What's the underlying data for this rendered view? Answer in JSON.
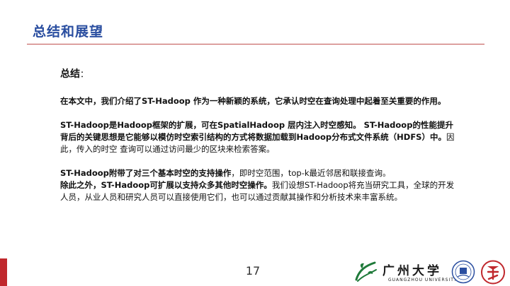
{
  "slide": {
    "title": "总结和展望",
    "heading": "总结",
    "heading_colon": "：",
    "p1": "在本文中，我们介绍了ST-Hadoop 作为一种新颖的系统，它承认时空在查询处理中起着至关重要的作用。",
    "p2_bold": "ST-Hadoop是Hadoop框架的扩展，可在SpatialHadoop 层内注入时空感知。 ST-Hadoop的性能提升背后的关键思想是它能够以模仿时空索引结构的方式将数据加载到Hadoop分布式文件系统（HDFS）中。",
    "p2_normal": "因此，传入的时空 查询可以通过访问最少的区块来检索答案。",
    "p3_bold_1": " ST-Hadoop附带了对三个基本时空的支持操作",
    "p3_normal_1": "，即时空范围，top-k最近邻居和联接查询。",
    "p3_bold_2": "除此之外，ST-Hadoop可扩展以支持众多其他时空操作。",
    "p3_normal_2": "我们设想ST-Hadoop将充当研究工具，全球的开发人员，从业人员和研究人员可以直接使用它们，也可以通过贡献其操作和分析技术来丰富系统。"
  },
  "footer": {
    "page_number": "17",
    "university_name": "广州大学",
    "university_name_en": "GUANGZHOU UNIVERSITY"
  },
  "colors": {
    "title": "#2a4ea0",
    "rule": "#c0504d",
    "footer_green": "#1f7a3a",
    "footer_red": "#c0282d"
  }
}
